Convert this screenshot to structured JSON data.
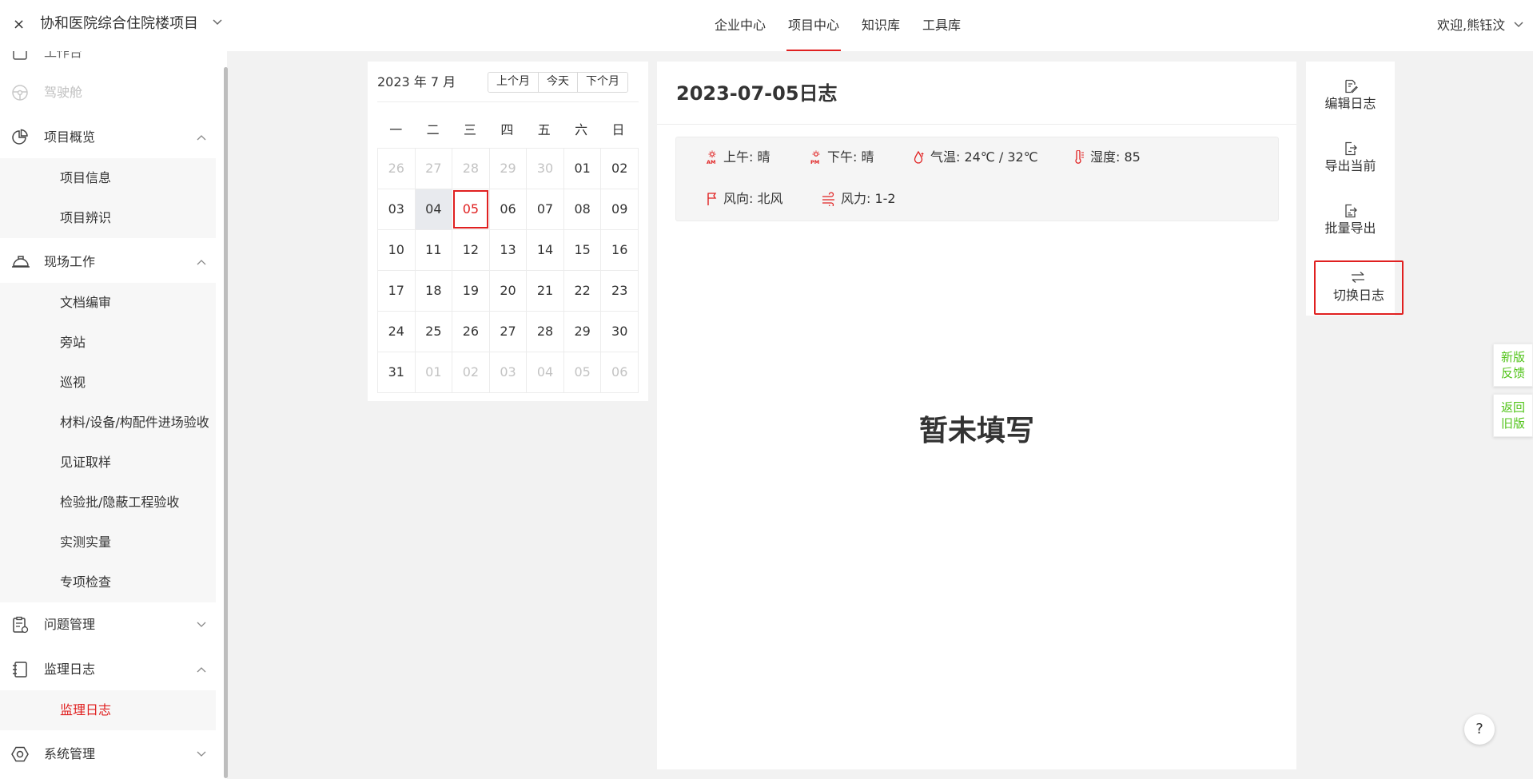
{
  "header": {
    "close_glyph": "×",
    "project_title": "协和医院综合住院楼项目",
    "nav": [
      {
        "label": "企业中心",
        "active": false
      },
      {
        "label": "项目中心",
        "active": true
      },
      {
        "label": "知识库",
        "active": false
      },
      {
        "label": "工具库",
        "active": false
      }
    ],
    "welcome": "欢迎,熊钰汶"
  },
  "sidebar": {
    "partial_item": "工作台",
    "cockpit": "驾驶舱",
    "groups": [
      {
        "label": "项目概览",
        "expanded": true,
        "icon": "pie-chart-icon",
        "items": [
          "项目信息",
          "项目辨识"
        ]
      },
      {
        "label": "现场工作",
        "expanded": true,
        "icon": "helmet-icon",
        "items": [
          "文档编审",
          "旁站",
          "巡视",
          "材料/设备/构配件进场验收",
          "见证取样",
          "检验批/隐蔽工程验收",
          "实测实量",
          "专项检查"
        ]
      },
      {
        "label": "问题管理",
        "expanded": false,
        "icon": "clipboard-icon",
        "items": []
      },
      {
        "label": "监理日志",
        "expanded": true,
        "icon": "notebook-icon",
        "items": [
          "监理日志"
        ],
        "active_item": "监理日志"
      },
      {
        "label": "系统管理",
        "expanded": false,
        "icon": "gear-icon",
        "items": []
      }
    ]
  },
  "calendar": {
    "title": "2023 年 7 月",
    "buttons": [
      "上个月",
      "今天",
      "下个月"
    ],
    "weekdays": [
      "一",
      "二",
      "三",
      "四",
      "五",
      "六",
      "日"
    ],
    "days": [
      {
        "d": "26",
        "other": true
      },
      {
        "d": "27",
        "other": true
      },
      {
        "d": "28",
        "other": true
      },
      {
        "d": "29",
        "other": true
      },
      {
        "d": "30",
        "other": true
      },
      {
        "d": "01"
      },
      {
        "d": "02"
      },
      {
        "d": "03"
      },
      {
        "d": "04",
        "today": true
      },
      {
        "d": "05",
        "selected": true
      },
      {
        "d": "06"
      },
      {
        "d": "07"
      },
      {
        "d": "08"
      },
      {
        "d": "09"
      },
      {
        "d": "10"
      },
      {
        "d": "11"
      },
      {
        "d": "12"
      },
      {
        "d": "13"
      },
      {
        "d": "14"
      },
      {
        "d": "15"
      },
      {
        "d": "16"
      },
      {
        "d": "17"
      },
      {
        "d": "18"
      },
      {
        "d": "19"
      },
      {
        "d": "20"
      },
      {
        "d": "21"
      },
      {
        "d": "22"
      },
      {
        "d": "23"
      },
      {
        "d": "24"
      },
      {
        "d": "25"
      },
      {
        "d": "26"
      },
      {
        "d": "27"
      },
      {
        "d": "28"
      },
      {
        "d": "29"
      },
      {
        "d": "30"
      },
      {
        "d": "31"
      },
      {
        "d": "01",
        "other": true
      },
      {
        "d": "02",
        "other": true
      },
      {
        "d": "03",
        "other": true
      },
      {
        "d": "04",
        "other": true
      },
      {
        "d": "05",
        "other": true
      },
      {
        "d": "06",
        "other": true
      }
    ]
  },
  "log": {
    "title": "2023-07-05日志",
    "weather": {
      "am": "上午: 晴",
      "pm": "下午: 晴",
      "temp": "气温: 24℃ / 32℃",
      "humidity": "湿度: 85",
      "wind_dir": "风向: 北风",
      "wind_force": "风力: 1-2"
    },
    "empty_text": "暂未填写"
  },
  "actions": [
    {
      "label": "编辑日志",
      "icon": "edit-icon"
    },
    {
      "label": "导出当前",
      "icon": "export-icon"
    },
    {
      "label": "批量导出",
      "icon": "batch-export-icon"
    },
    {
      "label": "切换日志",
      "icon": "switch-icon",
      "highlighted": true
    }
  ],
  "floating": {
    "feedback": "新版反馈",
    "old_version": "返回旧版",
    "help": "?"
  },
  "colors": {
    "accent": "#e02020",
    "green": "#52c41a",
    "background": "#f2f2f2"
  }
}
